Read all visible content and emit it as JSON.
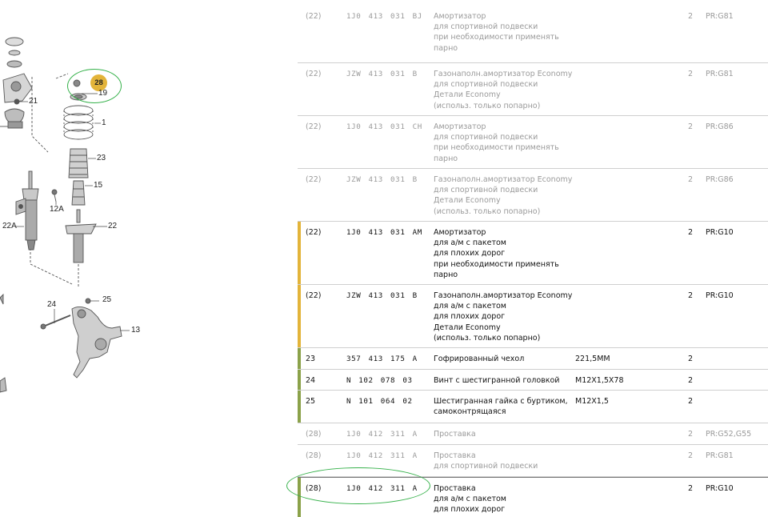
{
  "colors": {
    "highlight_yellow": "#e3b43a",
    "bar_yellow": "#e3b43a",
    "bar_olive": "#8ba24a",
    "green_circle": "#35b14a",
    "dim_text": "#9a9a9a"
  },
  "diagram": {
    "callouts": {
      "c21": "21",
      "c28": "28",
      "c19": "19",
      "c1": "1",
      "c23": "23",
      "c15": "15",
      "c12a": "12A",
      "c22a": "22A",
      "c22": "22",
      "c24": "24",
      "c25": "25",
      "c13": "13"
    }
  },
  "rows": [
    {
      "pos": "(22)",
      "code": "1J0 413 031 BJ",
      "desc": [
        "Амортизатор",
        "для спортивной подвески",
        "при необходимости применять",
        "парно"
      ],
      "spec": "",
      "qty": "2",
      "mod": "PR:G81"
    },
    {
      "pos": "(22)",
      "code": "JZW 413 031 B",
      "desc": [
        "Газонаполн.амортизатор Economy",
        "для спортивной подвески",
        "Детали Economy",
        "(использ. только попарно)"
      ],
      "spec": "",
      "qty": "2",
      "mod": "PR:G81"
    },
    {
      "pos": "(22)",
      "code": "1J0 413 031 CH",
      "desc": [
        "Амортизатор",
        "для спортивной подвески",
        "при необходимости применять",
        "парно"
      ],
      "spec": "",
      "qty": "2",
      "mod": "PR:G86"
    },
    {
      "pos": "(22)",
      "code": "JZW 413 031 B",
      "desc": [
        "Газонаполн.амортизатор Economy",
        "для спортивной подвески",
        "Детали Economy",
        "(использ. только попарно)"
      ],
      "spec": "",
      "qty": "2",
      "mod": "PR:G86"
    },
    {
      "pos": "(22)",
      "code": "1J0 413 031 AM",
      "desc": [
        "Амортизатор",
        "для а/м с пакетом",
        "для плохих дорог",
        "при необходимости применять",
        "парно"
      ],
      "spec": "",
      "qty": "2",
      "mod": "PR:G10"
    },
    {
      "pos": "(22)",
      "code": "JZW 413 031 B",
      "desc": [
        "Газонаполн.амортизатор Economy",
        "для а/м с пакетом",
        "для плохих дорог",
        "Детали Economy",
        "(использ. только попарно)"
      ],
      "spec": "",
      "qty": "2",
      "mod": "PR:G10"
    },
    {
      "pos": "23",
      "code": "357 413 175 A",
      "desc": [
        "Гофрированный чехол"
      ],
      "spec": "221,5MM",
      "qty": "2",
      "mod": ""
    },
    {
      "pos": "24",
      "code": "N 102 078 03",
      "desc": [
        "Винт с шестигранной головкой"
      ],
      "spec": "M12X1,5X78",
      "qty": "2",
      "mod": ""
    },
    {
      "pos": "25",
      "code": "N 101 064 02",
      "desc": [
        "Шестигранная гайка с буртиком,",
        "самоконтрящаяся"
      ],
      "spec": "M12X1,5",
      "qty": "2",
      "mod": ""
    },
    {
      "pos": "(28)",
      "code": "1J0 412 311 A",
      "desc": [
        "Проставка"
      ],
      "spec": "",
      "qty": "2",
      "mod": "PR:G52,G55"
    },
    {
      "pos": "(28)",
      "code": "1J0 412 311 A",
      "desc": [
        "Проставка",
        "для спортивной подвески"
      ],
      "spec": "",
      "qty": "2",
      "mod": "PR:G81"
    },
    {
      "pos": "(28)",
      "code": "1J0 412 311 A",
      "desc": [
        "Проставка",
        "для а/м с пакетом",
        "для плохих дорог"
      ],
      "spec": "",
      "qty": "2",
      "mod": "PR:G10"
    }
  ]
}
